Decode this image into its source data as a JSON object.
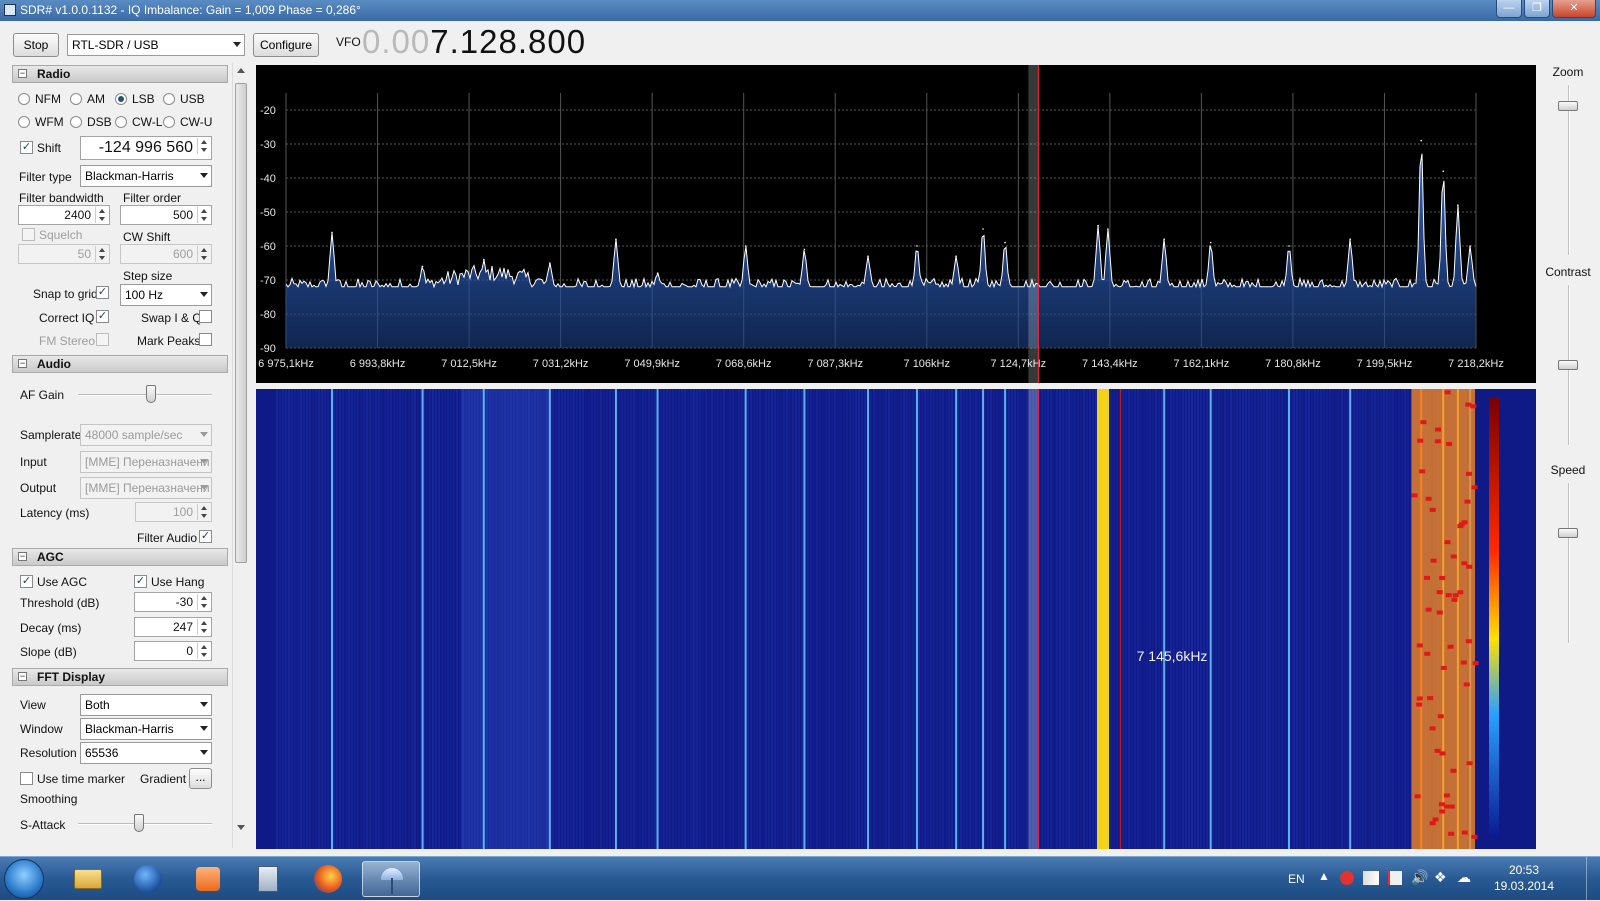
{
  "window": {
    "title": "SDR# v1.0.0.1132 - IQ Imbalance: Gain = 1,009 Phase = 0,286°",
    "min_glyph": "—",
    "max_glyph": "❐",
    "close_glyph": "✕"
  },
  "toolbar": {
    "stop_label": "Stop",
    "device": "RTL-SDR / USB",
    "configure_label": "Configure",
    "vfo_label": "VFO",
    "vfo_dim": "0.00",
    "vfo_main": "7.128.800"
  },
  "radio": {
    "header": "Radio",
    "modes": [
      "NFM",
      "AM",
      "LSB",
      "USB",
      "WFM",
      "DSB",
      "CW-L",
      "CW-U"
    ],
    "selected_mode": "LSB",
    "shift_label": "Shift",
    "shift_value": "-124 996 560",
    "filter_type_label": "Filter type",
    "filter_type": "Blackman-Harris",
    "filter_bandwidth_label": "Filter bandwidth",
    "filter_bandwidth": "2400",
    "filter_order_label": "Filter order",
    "filter_order": "500",
    "squelch_label": "Squelch",
    "squelch_value": "50",
    "cw_shift_label": "CW Shift",
    "cw_shift_value": "600",
    "step_size_label": "Step size",
    "step_size": "100 Hz",
    "snap_to_grid_label": "Snap to grid",
    "correct_iq_label": "Correct IQ",
    "swap_iq_label": "Swap I & Q",
    "fm_stereo_label": "FM Stereo",
    "mark_peaks_label": "Mark Peaks"
  },
  "audio": {
    "header": "Audio",
    "af_gain_label": "AF Gain",
    "af_gain_level": 0.55,
    "samplerate_label": "Samplerate",
    "samplerate": "48000 sample/sec",
    "input_label": "Input",
    "input": "[MME] Переназначени",
    "output_label": "Output",
    "output": "[MME] Переназначени",
    "latency_label": "Latency (ms)",
    "latency": "100",
    "filter_audio_label": "Filter Audio"
  },
  "agc": {
    "header": "AGC",
    "use_agc_label": "Use AGC",
    "use_hang_label": "Use Hang",
    "threshold_label": "Threshold (dB)",
    "threshold": "-30",
    "decay_label": "Decay (ms)",
    "decay": "247",
    "slope_label": "Slope (dB)",
    "slope": "0"
  },
  "fft": {
    "header": "FFT Display",
    "view_label": "View",
    "view": "Both",
    "window_label": "Window",
    "window": "Blackman-Harris",
    "resolution_label": "Resolution",
    "resolution": "65536",
    "use_time_marker_label": "Use time marker",
    "gradient_label": "Gradient",
    "gradient_btn": "...",
    "smoothing_label": "Smoothing",
    "s_attack_label": "S-Attack",
    "s_attack_level": 0.45
  },
  "chart_data": {
    "type": "line",
    "yticks": [
      -20,
      -30,
      -40,
      -50,
      -60,
      -70,
      -80,
      -90
    ],
    "ylim": [
      -90,
      -15
    ],
    "xticks": [
      "6 975,1kHz",
      "6 993,8kHz",
      "7 012,5kHz",
      "7 031,2kHz",
      "7 049,9kHz",
      "7 068,6kHz",
      "7 087,3kHz",
      "7 106kHz",
      "7 124,7kHz",
      "7 143,4kHz",
      "7 162,1kHz",
      "7 180,8kHz",
      "7 199,5kHz",
      "7 218,2kHz"
    ],
    "xlim_khz": [
      6975.1,
      7218.2
    ],
    "center_khz": 7128.8,
    "grid": true,
    "noise_floor_db": -72,
    "peaks": [
      {
        "khz": 6984.5,
        "db": -56
      },
      {
        "khz": 7003.0,
        "db": -66
      },
      {
        "khz": 7015.5,
        "db": -64
      },
      {
        "khz": 7029.0,
        "db": -65
      },
      {
        "khz": 7042.5,
        "db": -58
      },
      {
        "khz": 7051.0,
        "db": -68
      },
      {
        "khz": 7069.0,
        "db": -60
      },
      {
        "khz": 7081.0,
        "db": -61
      },
      {
        "khz": 7094.0,
        "db": -63
      },
      {
        "khz": 7104.0,
        "db": -60
      },
      {
        "khz": 7112.0,
        "db": -63
      },
      {
        "khz": 7117.5,
        "db": -55
      },
      {
        "khz": 7122.0,
        "db": -59
      },
      {
        "khz": 7141.0,
        "db": -54
      },
      {
        "khz": 7143.0,
        "db": -55
      },
      {
        "khz": 7154.5,
        "db": -58
      },
      {
        "khz": 7164.0,
        "db": -59
      },
      {
        "khz": 7180.0,
        "db": -60
      },
      {
        "khz": 7192.5,
        "db": -58
      },
      {
        "khz": 7207.0,
        "db": -29
      },
      {
        "khz": 7211.5,
        "db": -38
      },
      {
        "khz": 7214.5,
        "db": -48
      },
      {
        "khz": 7217.0,
        "db": -60
      }
    ],
    "cursor_label": "7 145,6kHz"
  },
  "side": {
    "zoom_label": "Zoom",
    "zoom_level": 0.9,
    "contrast_label": "Contrast",
    "contrast_level": 0.5,
    "speed_label": "Speed",
    "speed_level": 0.7
  },
  "taskbar": {
    "lang": "EN",
    "time": "20:53",
    "date": "19.03.2014"
  },
  "colors": {
    "spectrum_trace": "#ffffff",
    "spectrum_fill": "#1c3f86",
    "vfo_line": "#ff2a2a",
    "waterfall_bg": "#101a86"
  }
}
